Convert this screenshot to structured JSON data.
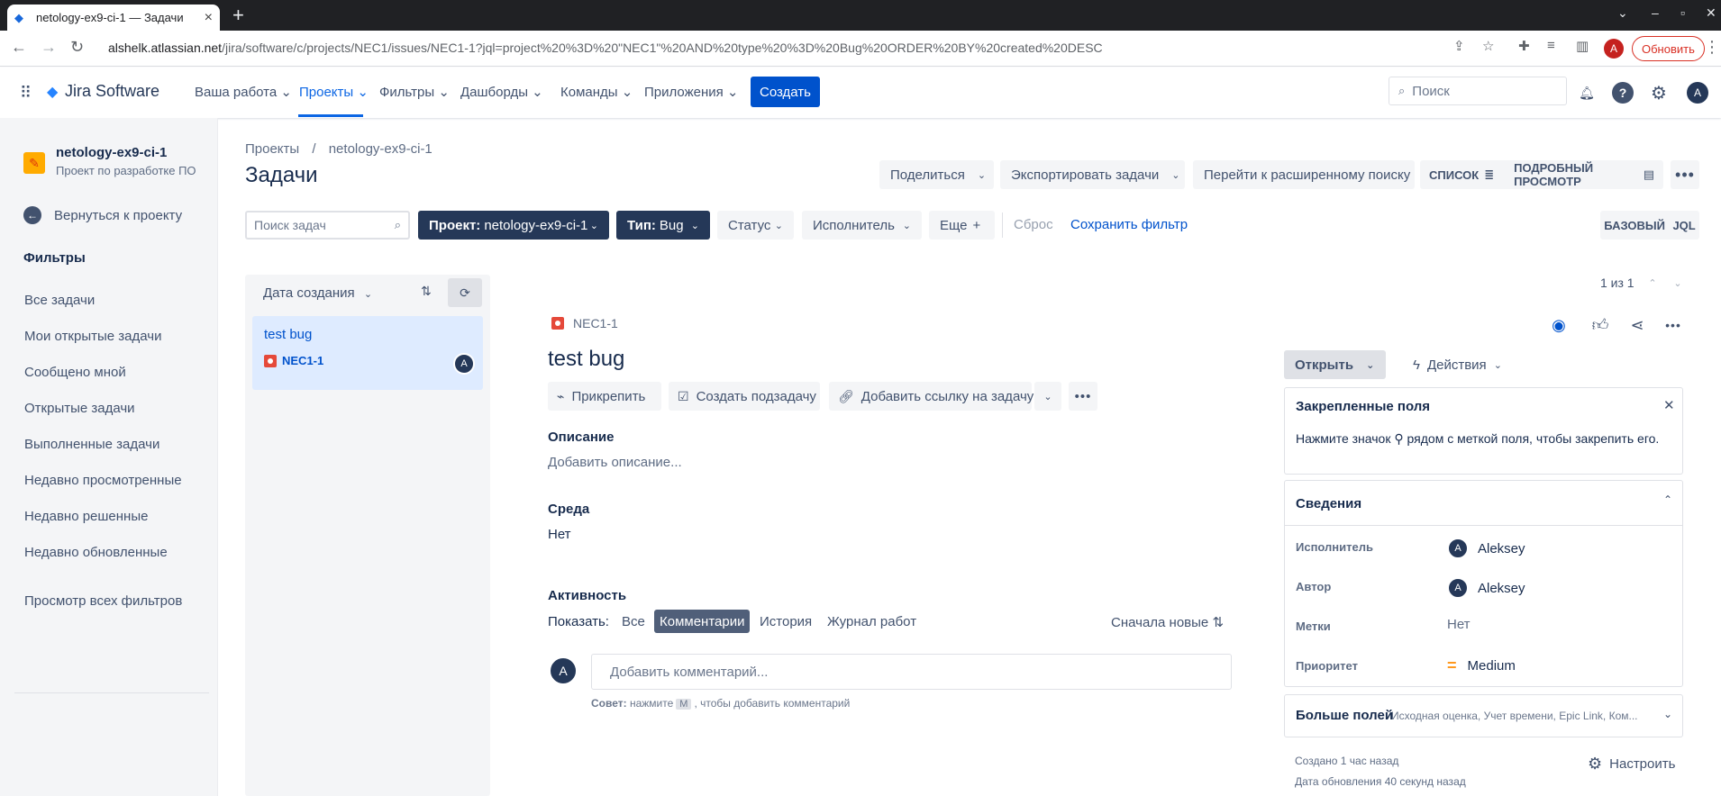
{
  "browser": {
    "tab_title": "netology-ex9-ci-1 — Задачи",
    "url_host": "alshelk.atlassian.net",
    "url_path": "/jira/software/c/projects/NEC1/issues/NEC1-1?jql=project%20%3D%20\"NEC1\"%20AND%20type%20%3D%20Bug%20ORDER%20BY%20created%20DESC",
    "update_label": "Обновить",
    "profile_initial": "A"
  },
  "nav": {
    "product": "Jira Software",
    "items": [
      "Ваша работа",
      "Проекты",
      "Фильтры",
      "Дашборды",
      "Команды",
      "Приложения"
    ],
    "create_label": "Создать",
    "search_placeholder": "Поиск",
    "profile_initial": "A"
  },
  "sidebar": {
    "project_name": "netology-ex9-ci-1",
    "project_sub": "Проект по разработке ПО",
    "back_label": "Вернуться к проекту",
    "filters_heading": "Фильтры",
    "items": [
      "Все задачи",
      "Мои открытые задачи",
      "Сообщено мной",
      "Открытые задачи",
      "Выполненные задачи",
      "Недавно просмотренные",
      "Недавно решенные",
      "Недавно обновленные"
    ],
    "all_filters": "Просмотр всех фильтров"
  },
  "header": {
    "breadcrumb_projects": "Проекты",
    "breadcrumb_sep": "/",
    "breadcrumb_project": "netology-ex9-ci-1",
    "title": "Задачи",
    "share": "Поделиться",
    "export": "Экспортировать задачи",
    "advanced": "Перейти к расширенному поиску",
    "view_list": "СПИСОК",
    "view_detail": "ПОДРОБНЫЙ ПРОСМОТР"
  },
  "filters": {
    "search_placeholder": "Поиск задач",
    "project_label": "Проект:",
    "project_value": "netology-ex9-ci-1",
    "type_label": "Тип:",
    "type_value": "Bug",
    "status": "Статус",
    "assignee": "Исполнитель",
    "more": "Еще",
    "reset": "Сброс",
    "save": "Сохранить фильтр",
    "mode_basic": "БАЗОВЫЙ",
    "mode_jql": "JQL"
  },
  "list": {
    "sort_label": "Дата создания",
    "items": [
      {
        "title": "test bug",
        "key": "NEC1-1",
        "assignee_initial": "A"
      }
    ]
  },
  "pager": "1 из 1",
  "issue": {
    "key": "NEC1-1",
    "title": "test bug",
    "attach": "Прикрепить",
    "subtask": "Создать подзадачу",
    "link": "Добавить ссылку на задачу",
    "desc_h": "Описание",
    "desc_v": "Добавить описание...",
    "env_h": "Среда",
    "env_v": "Нет",
    "activity_h": "Активность",
    "show_label": "Показать:",
    "tabs": [
      "Все",
      "Комментарии",
      "История",
      "Журнал работ"
    ],
    "active_tab": "Комментарии",
    "sort": "Сначала новые",
    "comment_placeholder": "Добавить комментарий...",
    "tip_bold": "Совет:",
    "tip_pre": "нажмите",
    "tip_key": "M",
    "tip_post": ", чтобы добавить комментарий",
    "commenter_initial": "A"
  },
  "right": {
    "status": "Открыть",
    "actions": "Действия",
    "pinned_h": "Закрепленные поля",
    "pinned_text_1": "Нажмите значок",
    "pinned_text_2": "рядом с меткой поля, чтобы закрепить его.",
    "details_h": "Сведения",
    "fields": [
      {
        "label": "Исполнитель",
        "value": "Aleksey",
        "avatar": "A"
      },
      {
        "label": "Автор",
        "value": "Aleksey",
        "avatar": "A"
      },
      {
        "label": "Метки",
        "value": "Нет"
      },
      {
        "label": "Приоритет",
        "value": "Medium"
      }
    ],
    "more_h": "Больше полей",
    "more_sub": "Исходная оценка, Учет времени, Epic Link, Ком...",
    "created": "Создано 1 час назад",
    "updated": "Дата обновления 40 секунд назад",
    "configure": "Настроить"
  },
  "colors": {
    "accent": "#0052cc",
    "dark_chip": "#253858",
    "bug": "#e5493a",
    "priority": "#ff991f"
  }
}
